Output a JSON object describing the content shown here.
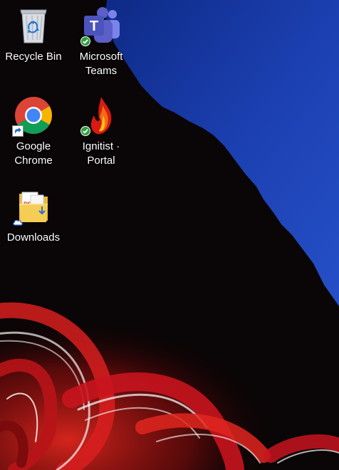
{
  "desktop": {
    "icons": [
      {
        "label": "Recycle Bin",
        "icon": "recycle-bin-icon"
      },
      {
        "label": "Microsoft Teams",
        "icon": "teams-icon",
        "badge": "sync-ok-badge"
      },
      {
        "label": "Google Chrome",
        "icon": "chrome-icon",
        "badge": "shortcut-arrow-badge"
      },
      {
        "label": "Ignitist · Portal",
        "icon": "flame-icon",
        "badge": "sync-ok-badge"
      },
      {
        "label": "Downloads",
        "icon": "folder-icon",
        "badge": "cloud-badge"
      }
    ]
  },
  "colors": {
    "sky": "#1a3fa8",
    "mountain": "#0a0506",
    "accent_red": "#c8141e",
    "teams_purple": "#5b5fc7",
    "sync_green": "#2e9e3e"
  }
}
